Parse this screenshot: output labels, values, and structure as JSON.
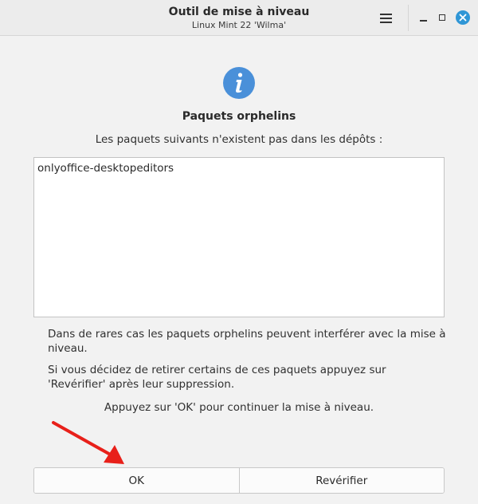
{
  "window": {
    "title": "Outil de mise à niveau",
    "subtitle": "Linux Mint 22 'Wilma'",
    "accent_color": "#2f96d6"
  },
  "titlebar_controls": {
    "menu_icon": "hamburger-menu-icon",
    "minimize_icon": "minimize-icon",
    "maximize_icon": "maximize-icon",
    "close_icon": "close-icon"
  },
  "dialog": {
    "icon": "info-icon",
    "heading": "Paquets orphelins",
    "subheading": "Les paquets suivants n'existent pas dans les dépôts :",
    "packages": [
      "onlyoffice-desktopeditors"
    ],
    "paragraph1": "Dans de rares cas les paquets orphelins peuvent interférer avec la mise à niveau.",
    "paragraph2": "Si vous décidez de retirer certains de ces paquets appuyez sur 'Revérifier' après leur suppression.",
    "paragraph3": "Appuyez sur 'OK' pour continuer la mise à niveau."
  },
  "annotation": {
    "arrow_color": "#e8201a"
  },
  "buttons": {
    "ok_label": "OK",
    "recheck_label": "Revérifier"
  }
}
